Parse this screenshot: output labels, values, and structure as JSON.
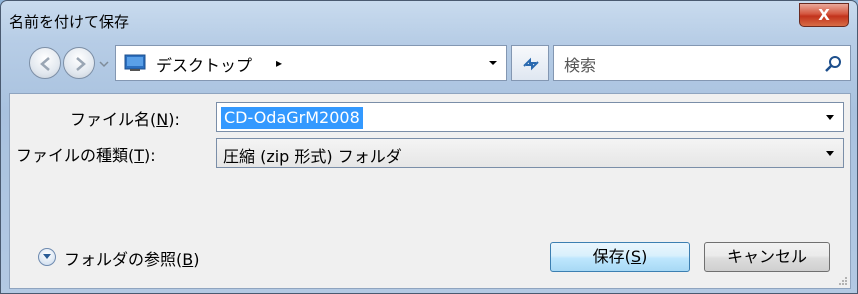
{
  "window": {
    "title": "名前を付けて保存",
    "close_label": "X"
  },
  "nav": {
    "back_icon": "back-arrow-icon",
    "forward_icon": "forward-arrow-icon",
    "address": {
      "location": "デスクトップ",
      "separator": "▸"
    },
    "search_placeholder": "検索"
  },
  "form": {
    "filename_label_prefix": "ファイル名(",
    "filename_label_key": "N",
    "filename_label_suffix": "):",
    "filename_value": "CD-OdaGrM2008",
    "filetype_label_prefix": "ファイルの種類(",
    "filetype_label_key": "T",
    "filetype_label_suffix": "):",
    "filetype_value": "圧縮 (zip 形式) フォルダ"
  },
  "footer": {
    "browse_prefix": "フォルダの参照(",
    "browse_key": "B",
    "browse_suffix": ")",
    "save_prefix": "保存(",
    "save_key": "S",
    "save_suffix": ")",
    "cancel_label": "キャンセル"
  }
}
